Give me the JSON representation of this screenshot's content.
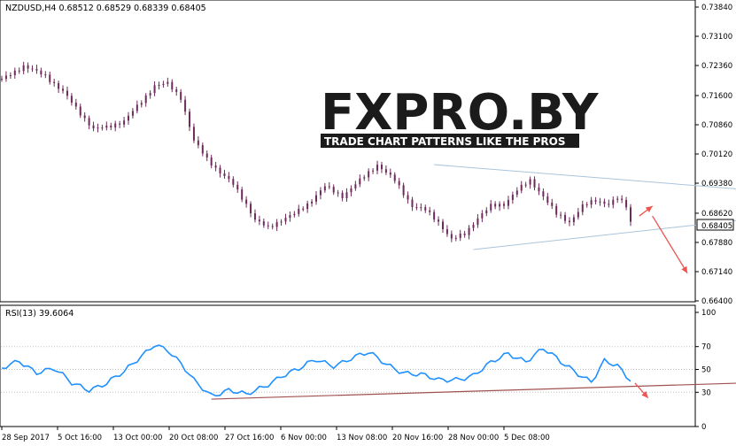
{
  "window": {
    "symbol_header": "NZDUSD,H4  0.68512 0.68529 0.68339 0.68405",
    "current_price_label": "0.68405"
  },
  "watermark": {
    "logo_text": "FXPRO.BY",
    "tagline": "TRADE CHART PATTERNS LIKE THE PROS"
  },
  "colors": {
    "background": "#ffffff",
    "axis": "#000000",
    "candle": "#6e2a5a",
    "rsi_line": "#1e90ff",
    "triangle_lines": "#a9c4dc",
    "rsi_trendline": "#a0524f",
    "arrow": "#ef5350",
    "logo_dark": "#1b1b1b",
    "logo_red": "#e23a2f"
  },
  "chart_data": [
    {
      "type": "candlestick",
      "title": "NZDUSD,H4  0.68512 0.68529 0.68339 0.68405",
      "ylim": [
        0.664,
        0.7384
      ],
      "y_ticks": [
        "0.73840",
        "0.73100",
        "0.72360",
        "0.71600",
        "0.70860",
        "0.70120",
        "0.69380",
        "0.68620",
        "0.67880",
        "0.67140",
        "0.66400"
      ],
      "x_ticks": [
        "28 Sep 2017",
        "5 Oct 16:00",
        "13 Oct 00:00",
        "20 Oct 08:00",
        "27 Oct 16:00",
        "6 Nov 00:00",
        "13 Nov 08:00",
        "20 Nov 16:00",
        "28 Nov 00:00",
        "5 Dec 08:00"
      ],
      "close_path": [
        [
          0,
          0.72
        ],
        [
          5,
          0.7235
        ],
        [
          10,
          0.721
        ],
        [
          14,
          0.717
        ],
        [
          18,
          0.7115
        ],
        [
          21,
          0.7075
        ],
        [
          24,
          0.708
        ],
        [
          28,
          0.7095
        ],
        [
          32,
          0.7145
        ],
        [
          35,
          0.7185
        ],
        [
          38,
          0.719
        ],
        [
          41,
          0.7155
        ],
        [
          44,
          0.7045
        ],
        [
          47,
          0.7
        ],
        [
          50,
          0.6965
        ],
        [
          53,
          0.6935
        ],
        [
          56,
          0.6885
        ],
        [
          58,
          0.6845
        ],
        [
          61,
          0.6825
        ],
        [
          64,
          0.6845
        ],
        [
          67,
          0.686
        ],
        [
          70,
          0.6885
        ],
        [
          74,
          0.693
        ],
        [
          78,
          0.6905
        ],
        [
          82,
          0.6945
        ],
        [
          86,
          0.6985
        ],
        [
          90,
          0.6945
        ],
        [
          94,
          0.688
        ],
        [
          97,
          0.687
        ],
        [
          100,
          0.684
        ],
        [
          103,
          0.6795
        ],
        [
          106,
          0.681
        ],
        [
          109,
          0.685
        ],
        [
          112,
          0.688
        ],
        [
          115,
          0.6885
        ],
        [
          118,
          0.692
        ],
        [
          121,
          0.6945
        ],
        [
          124,
          0.6905
        ],
        [
          127,
          0.686
        ],
        [
          130,
          0.684
        ],
        [
          133,
          0.688
        ],
        [
          136,
          0.6895
        ],
        [
          139,
          0.6885
        ],
        [
          141,
          0.69
        ],
        [
          143,
          0.688
        ],
        [
          144,
          0.68405
        ]
      ],
      "triangle_upper": [
        [
          99,
          0.6985
        ],
        [
          178,
          0.6915
        ]
      ],
      "triangle_lower": [
        [
          108,
          0.677
        ],
        [
          186,
          0.6865
        ]
      ],
      "forecast_arrow_up": [
        [
          146,
          0.6855
        ],
        [
          149,
          0.688
        ]
      ],
      "forecast_arrow_down": [
        [
          149,
          0.6855
        ],
        [
          157,
          0.671
        ]
      ]
    },
    {
      "type": "line",
      "title": "RSI(13) 39.6064",
      "ylim": [
        0,
        100
      ],
      "y_ticks": [
        "100",
        "70",
        "50",
        "30",
        "0"
      ],
      "levels": [
        70,
        50,
        30
      ],
      "path": [
        [
          0,
          50
        ],
        [
          4,
          58
        ],
        [
          8,
          48
        ],
        [
          12,
          50
        ],
        [
          16,
          38
        ],
        [
          20,
          33
        ],
        [
          24,
          38
        ],
        [
          28,
          47
        ],
        [
          32,
          62
        ],
        [
          35,
          73
        ],
        [
          38,
          67
        ],
        [
          41,
          54
        ],
        [
          44,
          40
        ],
        [
          48,
          28
        ],
        [
          52,
          32
        ],
        [
          56,
          27
        ],
        [
          60,
          35
        ],
        [
          64,
          45
        ],
        [
          68,
          50
        ],
        [
          72,
          58
        ],
        [
          76,
          54
        ],
        [
          80,
          60
        ],
        [
          84,
          64
        ],
        [
          88,
          55
        ],
        [
          92,
          48
        ],
        [
          96,
          45
        ],
        [
          100,
          40
        ],
        [
          104,
          42
        ],
        [
          108,
          45
        ],
        [
          112,
          55
        ],
        [
          116,
          64
        ],
        [
          120,
          58
        ],
        [
          124,
          68
        ],
        [
          128,
          56
        ],
        [
          132,
          47
        ],
        [
          135,
          40
        ],
        [
          138,
          57
        ],
        [
          141,
          52
        ],
        [
          144,
          39.6
        ]
      ],
      "trendline": [
        [
          48,
          24
        ],
        [
          186,
          40
        ]
      ],
      "forecast_arrow": [
        [
          145,
          38
        ],
        [
          148,
          25
        ]
      ]
    }
  ]
}
